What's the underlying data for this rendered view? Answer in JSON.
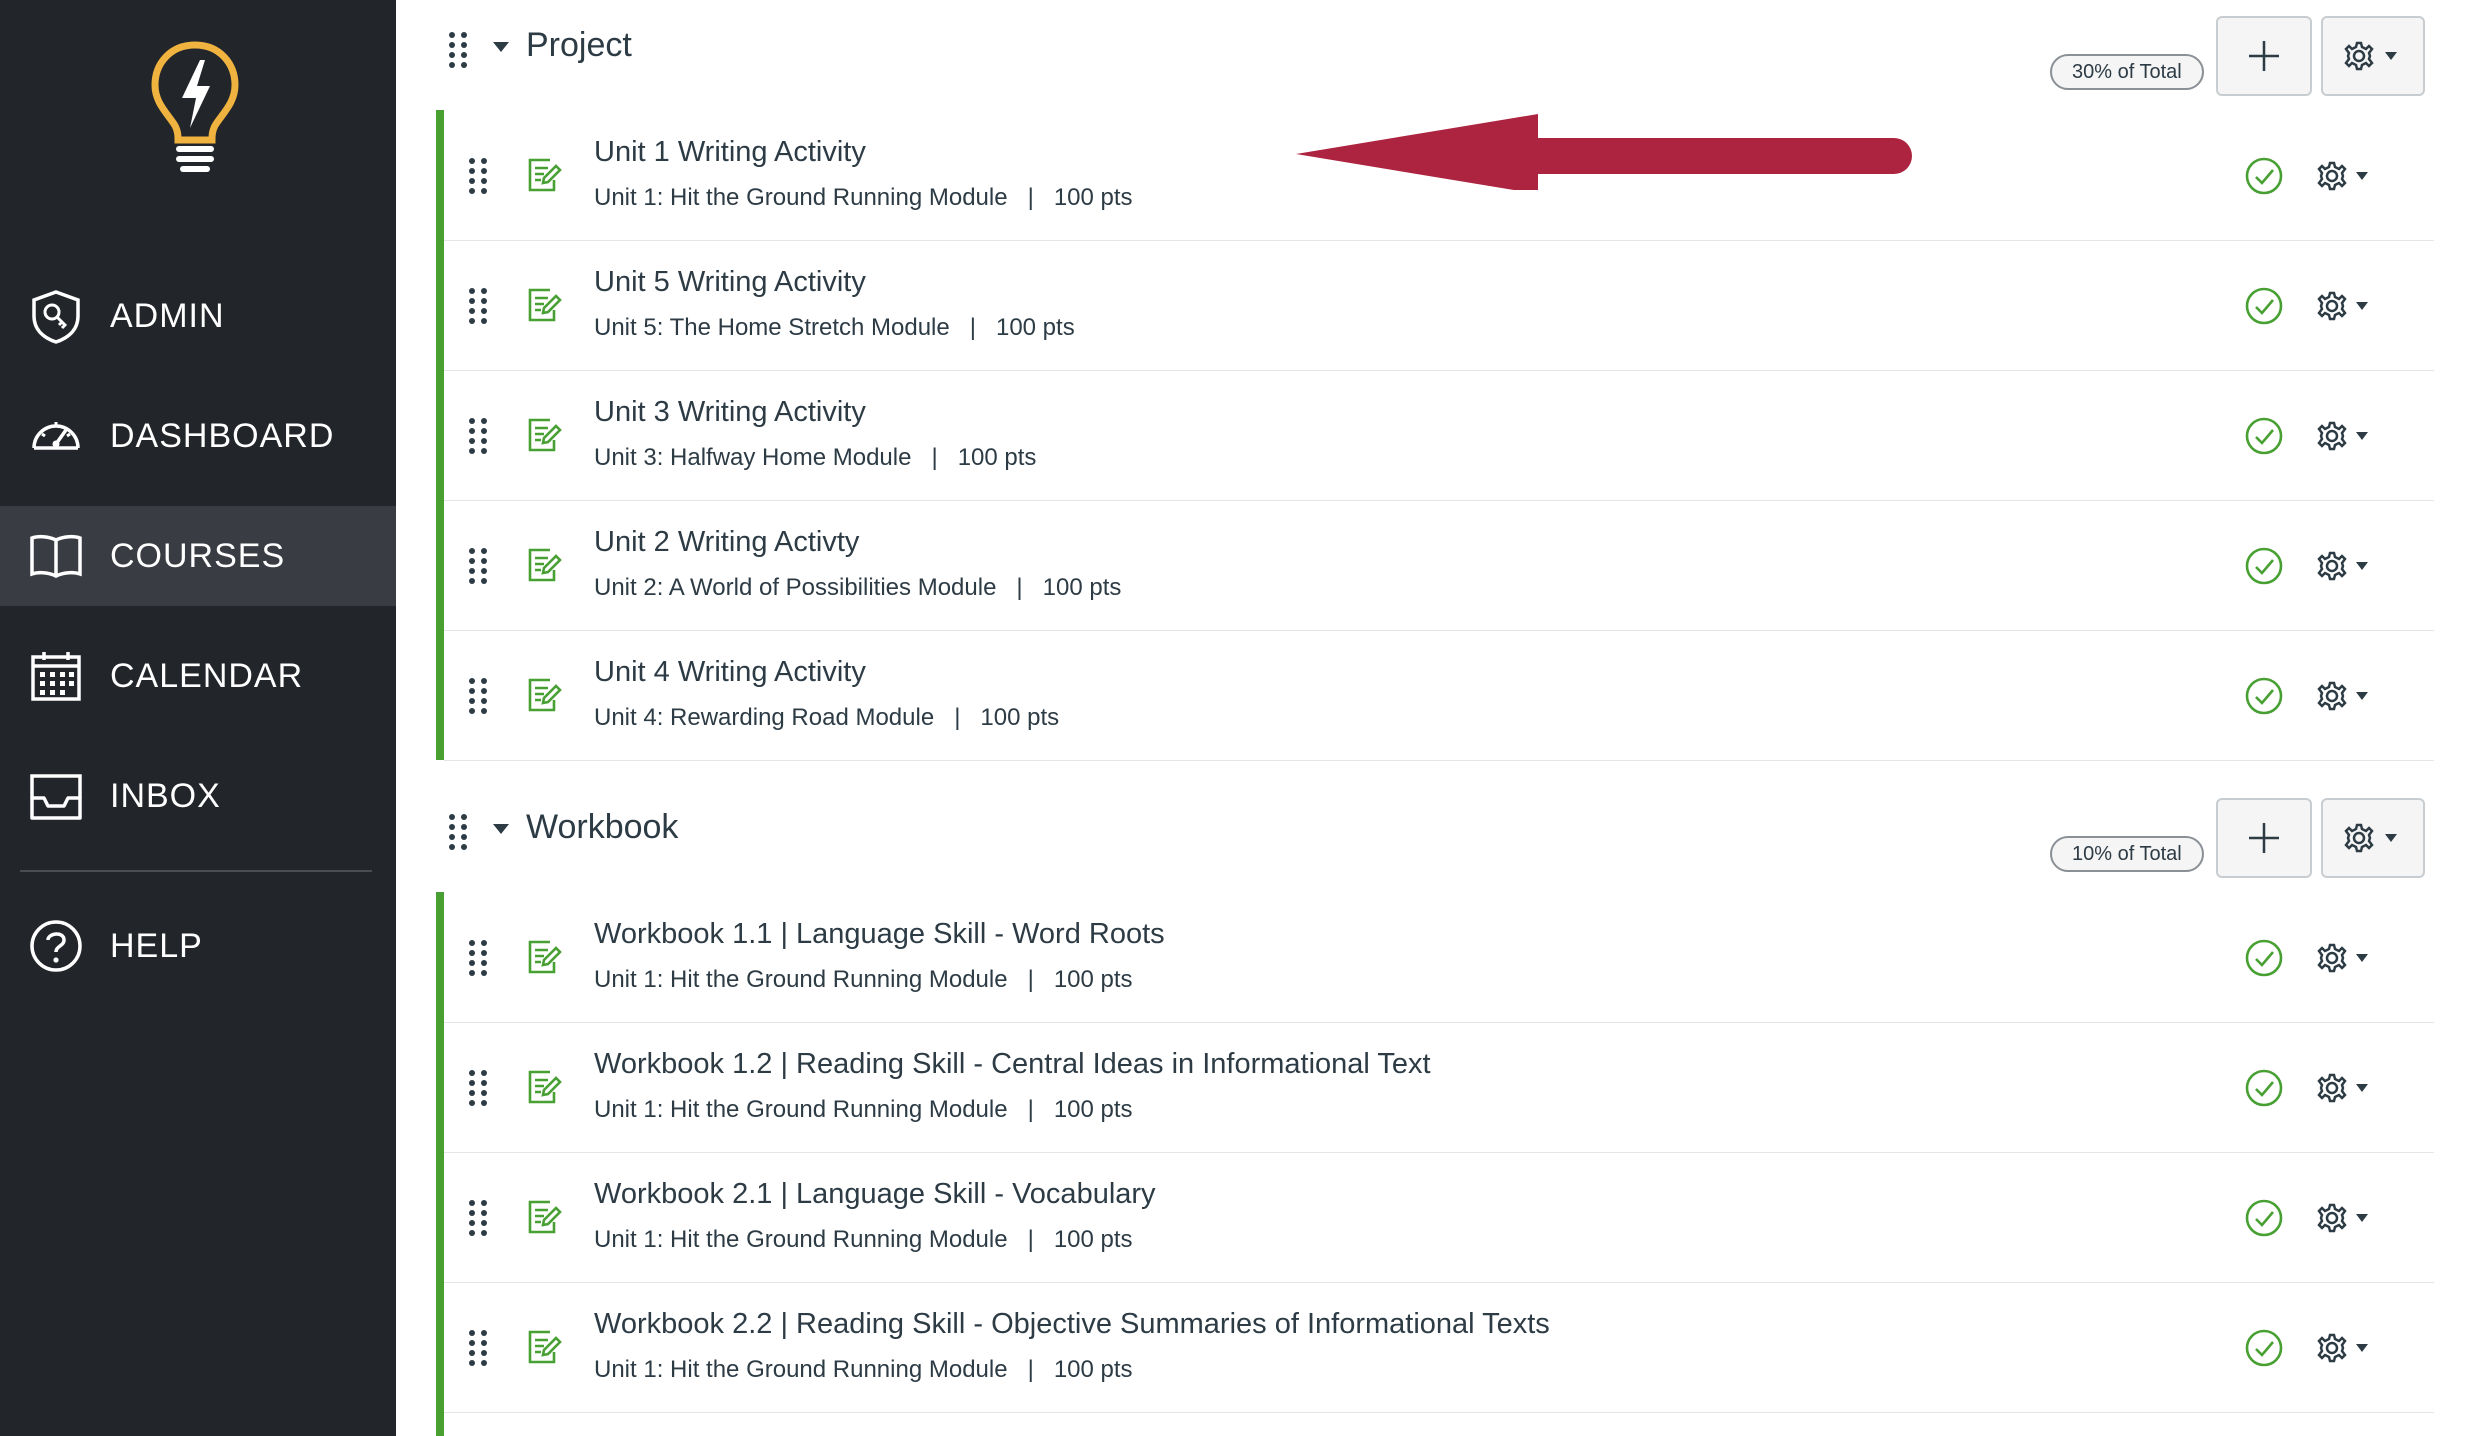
{
  "sidebar": {
    "items": [
      {
        "label": "ADMIN",
        "icon": "admin-shield-icon"
      },
      {
        "label": "DASHBOARD",
        "icon": "speedometer-icon"
      },
      {
        "label": "COURSES",
        "icon": "book-icon",
        "active": true
      },
      {
        "label": "CALENDAR",
        "icon": "calendar-icon"
      },
      {
        "label": "INBOX",
        "icon": "inbox-icon"
      },
      {
        "label": "HELP",
        "icon": "help-circle-icon"
      }
    ]
  },
  "colors": {
    "sidebar_bg": "#22252a",
    "sidebar_active": "#393c42",
    "logo": "#f0b33f",
    "published_green": "#48a033",
    "annotation_arrow": "#ad2441"
  },
  "groups": [
    {
      "title": "Project",
      "weight": "30% of Total",
      "items": [
        {
          "title": "Unit 1 Writing Activity",
          "module": "Unit 1: Hit the Ground Running Module",
          "points": "100 pts"
        },
        {
          "title": "Unit 5 Writing Activity",
          "module": "Unit 5: The Home Stretch Module",
          "points": "100 pts"
        },
        {
          "title": "Unit 3 Writing Activity",
          "module": "Unit 3: Halfway Home Module",
          "points": "100 pts"
        },
        {
          "title": "Unit 2 Writing Activty",
          "module": "Unit 2: A World of Possibilities Module",
          "points": "100 pts"
        },
        {
          "title": "Unit 4 Writing Activity",
          "module": "Unit 4: Rewarding Road Module",
          "points": "100 pts"
        }
      ]
    },
    {
      "title": "Workbook",
      "weight": "10% of Total",
      "items": [
        {
          "title": "Workbook 1.1 | Language Skill - Word Roots",
          "module": "Unit 1: Hit the Ground Running Module",
          "points": "100 pts"
        },
        {
          "title": "Workbook 1.2 | Reading Skill - Central Ideas in Informational Text",
          "module": "Unit 1: Hit the Ground Running Module",
          "points": "100 pts"
        },
        {
          "title": "Workbook 2.1 | Language Skill - Vocabulary",
          "module": "Unit 1: Hit the Ground Running Module",
          "points": "100 pts"
        },
        {
          "title": "Workbook 2.2 | Reading Skill - Objective Summaries of Informational Texts",
          "module": "Unit 1: Hit the Ground Running Module",
          "points": "100 pts"
        }
      ]
    }
  ],
  "separator": "|"
}
